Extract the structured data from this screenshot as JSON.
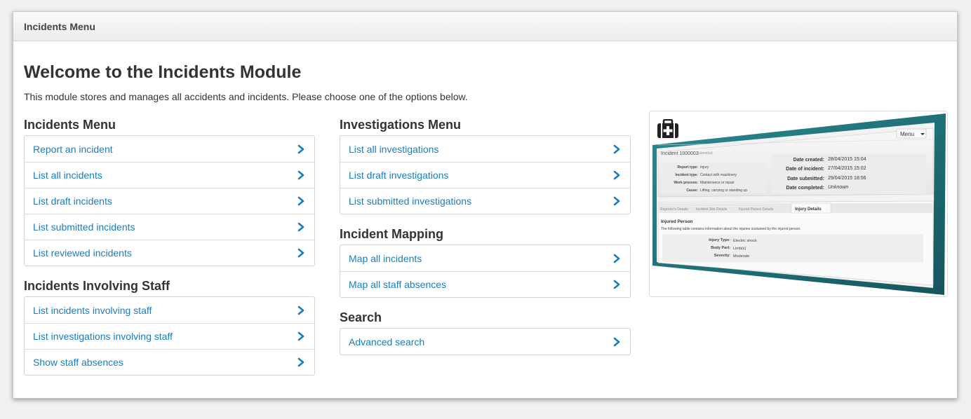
{
  "header": {
    "title": "Incidents Menu"
  },
  "welcome": {
    "heading": "Welcome to the Incidents Module",
    "intro": "This module stores and manages all accidents and incidents. Please choose one of the options below."
  },
  "sections": {
    "incidents": {
      "title": "Incidents Menu",
      "items": [
        "Report an incident",
        "List all incidents",
        "List draft incidents",
        "List submitted incidents",
        "List reviewed incidents"
      ]
    },
    "staff": {
      "title": "Incidents Involving Staff",
      "items": [
        "List incidents involving staff",
        "List investigations involving staff",
        "Show staff absences"
      ]
    },
    "investigations": {
      "title": "Investigations Menu",
      "items": [
        "List all investigations",
        "List draft investigations",
        "List submitted investigations"
      ]
    },
    "mapping": {
      "title": "Incident Mapping",
      "items": [
        "Map all incidents",
        "Map all staff absences"
      ]
    },
    "search": {
      "title": "Search",
      "items": [
        "Advanced search"
      ]
    }
  },
  "preview": {
    "icon": "first-aid-kit-icon",
    "menu_button": "Menu",
    "incident_title": "Incident 1000002",
    "status": "Submitted",
    "report_type_label": "Report type:",
    "report_type": "Injury",
    "incident_type_label": "Incident type:",
    "incident_type": "Contact with machinery",
    "work_process_label": "Work process:",
    "work_process": "Maintenance or repair",
    "cause_label": "Cause:",
    "cause": "Lifting, carrying or standing up",
    "date_created_label": "Date created:",
    "date_created": "28/04/2015 15:04",
    "date_incident_label": "Date of incident:",
    "date_incident": "27/04/2015 15:02",
    "date_submitted_label": "Date submitted:",
    "date_submitted": "29/04/2015 18:56",
    "date_completed_label": "Date completed:",
    "date_completed": "Unknown",
    "tabs": [
      "Reporter's Details",
      "Incident Site Details",
      "Injured Person Details",
      "Injury Details"
    ],
    "injured_heading": "Injured Person",
    "injured_desc": "The following table contains information about the injuries sustained by the injured person.",
    "injury_type_label": "Injury Type:",
    "injury_type": "Electric shock",
    "body_part_label": "Body Part:",
    "body_part": "Limb(s)",
    "severity_label": "Severity:",
    "severity": "Moderate"
  },
  "colors": {
    "link": "#1a7dbf",
    "accent_teal": "#1f6f7a"
  }
}
